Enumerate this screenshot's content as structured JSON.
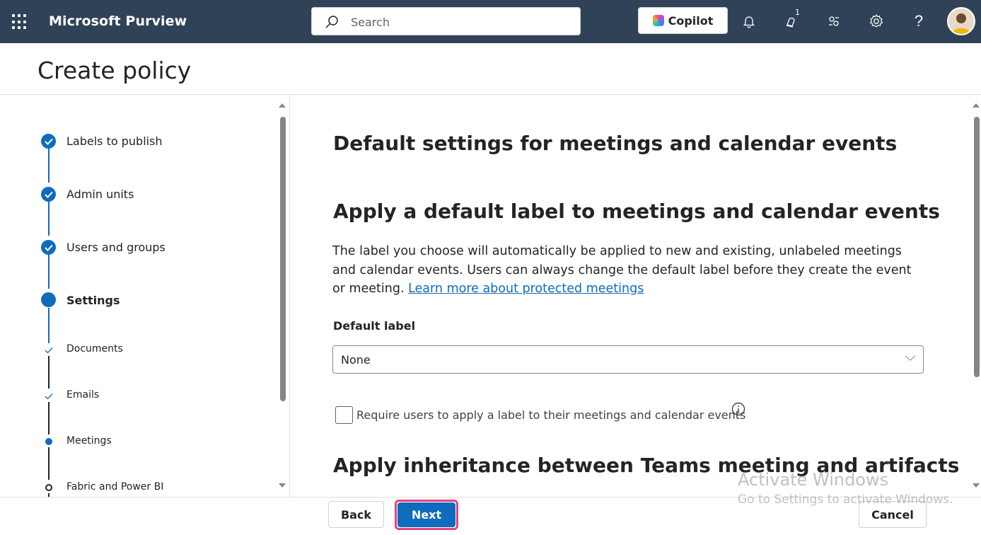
{
  "header": {
    "app_title": "Microsoft Purview",
    "search_placeholder": "Search",
    "copilot_label": "Copilot",
    "notification_badge": "1",
    "icons": [
      "waffle-icon",
      "search-icon",
      "bell-icon",
      "notification-icon",
      "share-icon",
      "gear-icon",
      "help-icon",
      "avatar"
    ]
  },
  "page": {
    "title": "Create policy"
  },
  "steps": [
    {
      "label": "Labels to publish",
      "state": "done"
    },
    {
      "label": "Admin units",
      "state": "done"
    },
    {
      "label": "Users and groups",
      "state": "done"
    },
    {
      "label": "Settings",
      "state": "current"
    }
  ],
  "substeps": [
    {
      "label": "Documents",
      "state": "done"
    },
    {
      "label": "Emails",
      "state": "done"
    },
    {
      "label": "Meetings",
      "state": "current"
    },
    {
      "label": "Fabric and Power BI",
      "state": "todo"
    }
  ],
  "content": {
    "heading": "Default settings for meetings and calendar events",
    "section1_heading": "Apply a default label to meetings and calendar events",
    "description": "The label you choose will automatically be applied to new and existing, unlabeled meetings and calendar events. Users can always change the default label before they create the event or meeting. ",
    "learn_more_link": "Learn more about protected meetings",
    "default_label_title": "Default label",
    "default_label_value": "None",
    "require_checkbox_label": "Require users to apply a label to their meetings and calendar events",
    "section2_heading": "Apply inheritance between Teams meeting and artifacts"
  },
  "watermark": {
    "line1": "Activate Windows",
    "line2": "Go to Settings to activate Windows."
  },
  "footer": {
    "back_label": "Back",
    "next_label": "Next",
    "cancel_label": "Cancel"
  },
  "colors": {
    "topbar": "#2f4257",
    "accent": "#0f6cbd",
    "highlight": "#e0457b"
  }
}
